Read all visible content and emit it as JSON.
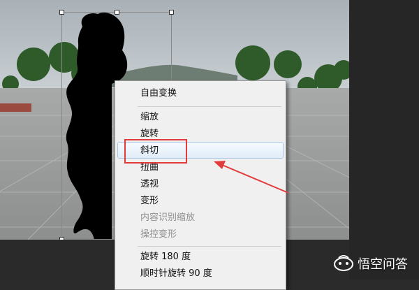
{
  "context_menu": {
    "items": [
      {
        "label": "自由变换",
        "enabled": true
      },
      {
        "label": "缩放",
        "enabled": true
      },
      {
        "label": "旋转",
        "enabled": true
      },
      {
        "label": "斜切",
        "enabled": true,
        "highlighted": true
      },
      {
        "label": "扭曲",
        "enabled": true
      },
      {
        "label": "透视",
        "enabled": true
      },
      {
        "label": "变形",
        "enabled": true
      },
      {
        "label": "内容识别缩放",
        "enabled": false
      },
      {
        "label": "操控变形",
        "enabled": false
      },
      {
        "label": "旋转 180 度",
        "enabled": true
      },
      {
        "label": "顺时针旋转 90 度",
        "enabled": true
      }
    ]
  },
  "annotation": {
    "color": "#e23b3b",
    "target": "斜切"
  },
  "watermark": {
    "text": "悟空问答"
  },
  "colors": {
    "menu_bg": "#f0f0f0",
    "highlight_border": "#aac8e6",
    "panel_bg": "#2b2b2b",
    "silhouette": "#000000",
    "annotation_red": "#e23b3b"
  }
}
